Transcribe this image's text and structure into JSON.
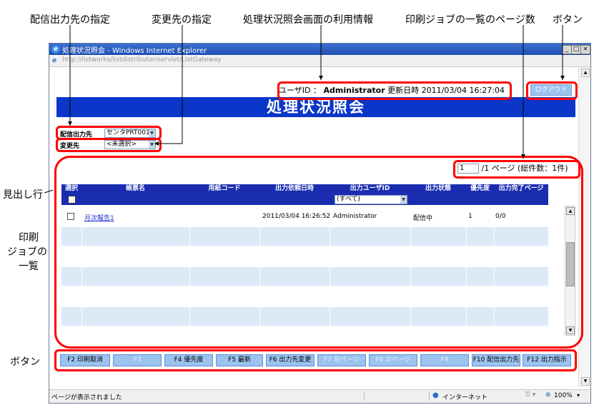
{
  "annotations": {
    "top": [
      "配信出力先の指定",
      "変更先の指定",
      "処理状況照会画面の利用情報",
      "印刷ジョブの一覧のページ数",
      "ボタン"
    ],
    "left_heading_row": "見出し行",
    "left_job_list_1": "印刷",
    "left_job_list_2": "ジョブの",
    "left_job_list_3": "一覧",
    "left_buttons": "ボタン"
  },
  "window": {
    "title": "処理状況照会 - Windows Internet Explorer",
    "url": "http://listworks/listdistributor/servlet/ListGateway",
    "status_text": "ページが表示されました",
    "zone": "インターネット",
    "zoom": "100%"
  },
  "header": {
    "user_label": "ユーザID ：",
    "user_name": "Administrator",
    "updated_label": "更新日時",
    "updated_at": "2011/03/04 16:27:04",
    "logout_label": "ログアウト",
    "page_title": "処理状況照会"
  },
  "filters": {
    "output_label": "配信出力先",
    "output_value": "センタPRT001",
    "change_label": "変更先",
    "change_value": "<未選択>"
  },
  "pager": {
    "current": "1",
    "total": "/1",
    "suffix": "ページ (総件数：1件)"
  },
  "table": {
    "columns": [
      "選択",
      "帳票名",
      "用紙コード",
      "出力依頼日時",
      "出力ユーザID",
      "出力状態",
      "優先度",
      "出力完了ページ"
    ],
    "user_filter": "(すべて)",
    "rows": [
      {
        "checked": false,
        "name": "月次報告1",
        "paper": "",
        "requested": "2011/03/04 16:26:52",
        "user": "Administrator",
        "status": "配信中",
        "priority": "1",
        "pages": "0/0"
      }
    ]
  },
  "function_keys": [
    {
      "label": "F2 印刷取消",
      "enabled": true
    },
    {
      "label": "F3",
      "enabled": false
    },
    {
      "label": "F4 優先度",
      "enabled": true
    },
    {
      "label": "F5 最新",
      "enabled": true
    },
    {
      "label": "F6 出力先変更",
      "enabled": true
    },
    {
      "label": "F7 前ページ",
      "enabled": false
    },
    {
      "label": "F8 次ページ",
      "enabled": false
    },
    {
      "label": "F9",
      "enabled": false
    },
    {
      "label": "F10 配信出力先",
      "enabled": true
    },
    {
      "label": "F12 出力指示",
      "enabled": true
    }
  ]
}
